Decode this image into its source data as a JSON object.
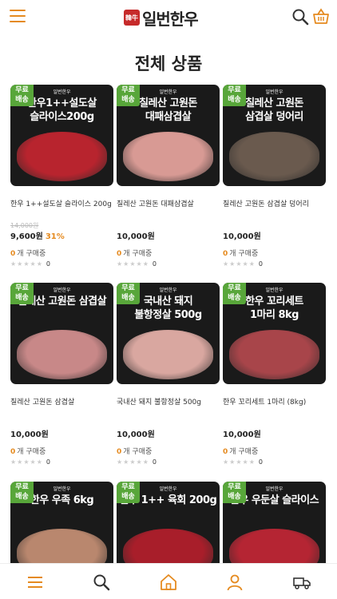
{
  "header": {
    "logo_seal": "韓牛",
    "logo_text": "일번한우"
  },
  "page_title": "전체 상품",
  "badge_text": [
    "무료",
    "배송"
  ],
  "brand_small": "일번한우",
  "products": [
    {
      "img_title": "한우1++설도살 슬라이스200g",
      "img_lines": [
        "한우1++설도살",
        "슬라이스200g"
      ],
      "name": "한우 1++설도살 슬라이스 200g",
      "original_price": "14,000원",
      "price": "9,600원",
      "discount": "31%",
      "buying_count": "0",
      "buying_label": "개 구매중",
      "stars": "★★★★★",
      "reviews": "0",
      "photo_color": "#b8242e"
    },
    {
      "img_title": "칠레산 고원돈 대패삼겹살",
      "img_lines": [
        "칠레산 고원돈",
        "대패삼겹살"
      ],
      "name": "칠레산 고원돈 대패삼겹살",
      "original_price": "",
      "price": "10,000원",
      "discount": "",
      "buying_count": "0",
      "buying_label": "개 구매중",
      "stars": "★★★★★",
      "reviews": "0",
      "photo_color": "#d89a94"
    },
    {
      "img_title": "칠레산 고원돈 삼겹살 덩어리",
      "img_lines": [
        "칠레산 고원돈",
        "삼겹살 덩어리"
      ],
      "name": "칠레산 고원돈 삼겹살 덩어리",
      "original_price": "",
      "price": "10,000원",
      "discount": "",
      "buying_count": "0",
      "buying_label": "개 구매중",
      "stars": "★★★★★",
      "reviews": "0",
      "photo_color": "#6a5a4e"
    },
    {
      "img_title": "칠레산 고원돈 삼겹살",
      "img_lines": [
        "칠레산 고원돈 삼겹살"
      ],
      "name": "칠레산 고원돈 삼겹살",
      "original_price": "",
      "price": "10,000원",
      "discount": "",
      "buying_count": "0",
      "buying_label": "개 구매중",
      "stars": "★★★★★",
      "reviews": "0",
      "photo_color": "#c88888"
    },
    {
      "img_title": "국내산 돼지 불항정살 500g",
      "img_lines": [
        "국내산 돼지",
        "불항정살 500g"
      ],
      "name": "국내산 돼지 불항정살 500g",
      "original_price": "",
      "price": "10,000원",
      "discount": "",
      "buying_count": "0",
      "buying_label": "개 구매중",
      "stars": "★★★★★",
      "reviews": "0",
      "photo_color": "#d9a7a0"
    },
    {
      "img_title": "한우 꼬리세트 1마리 8kg",
      "img_lines": [
        "한우 꼬리세트",
        "1마리 8kg"
      ],
      "name": "한우 꼬리세트 1마리 (8kg)",
      "original_price": "",
      "price": "10,000원",
      "discount": "",
      "buying_count": "0",
      "buying_label": "개 구매중",
      "stars": "★★★★★",
      "reviews": "0",
      "photo_color": "#a8454a"
    },
    {
      "img_title": "한우 우족 6kg",
      "img_lines": [
        "한우 우족 6kg"
      ],
      "name": "",
      "original_price": "",
      "price": "",
      "discount": "",
      "buying_count": "",
      "buying_label": "",
      "stars": "",
      "reviews": "",
      "photo_color": "#b9876e"
    },
    {
      "img_title": "한우 1++ 육회 200g",
      "img_lines": [
        "한우 1++ 육회 200g"
      ],
      "name": "",
      "original_price": "",
      "price": "",
      "discount": "",
      "buying_count": "",
      "buying_label": "",
      "stars": "",
      "reviews": "",
      "photo_color": "#a81e2a"
    },
    {
      "img_title": "한우 우둔살 슬라이스",
      "img_lines": [
        "한우 우둔살 슬라이스"
      ],
      "name": "",
      "original_price": "",
      "price": "",
      "discount": "",
      "buying_count": "",
      "buying_label": "",
      "stars": "",
      "reviews": "",
      "photo_color": "#b52533"
    }
  ],
  "bottom_nav": [
    "menu-icon",
    "search-icon",
    "home-icon",
    "user-icon",
    "delivery-truck-icon"
  ],
  "colors": {
    "accent": "#e58a1f",
    "badge": "#58a63a",
    "card_bg": "#1a1a1a"
  }
}
